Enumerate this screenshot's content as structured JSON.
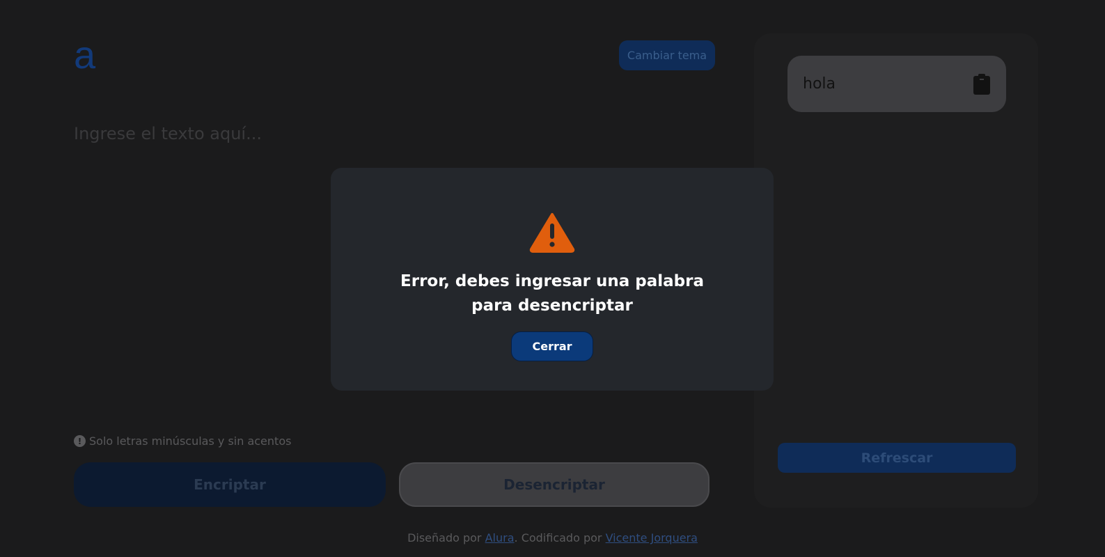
{
  "header": {
    "logo_text": "a",
    "theme_button_label": "Cambiar tema"
  },
  "input": {
    "placeholder": "Ingrese el texto aquí..."
  },
  "hint": {
    "icon_glyph": "!",
    "text": "Solo letras minúsculas y sin acentos"
  },
  "actions": {
    "encrypt_label": "Encriptar",
    "decrypt_label": "Desencriptar"
  },
  "output": {
    "text": "hola",
    "refresh_label": "Refrescar"
  },
  "footer": {
    "designed_by_prefix": "Diseñado por ",
    "designer": "Alura",
    "coded_by_prefix": ". Codificado por ",
    "coder": "Vicente Jorquera"
  },
  "modal": {
    "message": "Error, debes ingresar una palabra para desencriptar",
    "close_label": "Cerrar"
  },
  "colors": {
    "warning": "#e05e0d",
    "accent": "#0b3a7a"
  },
  "icons": {
    "warning": "warning-icon",
    "clipboard": "clipboard-icon",
    "info": "info-icon"
  }
}
